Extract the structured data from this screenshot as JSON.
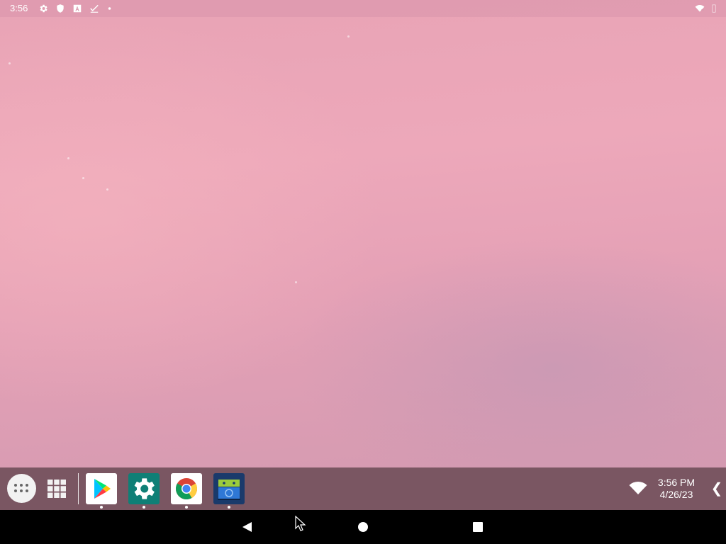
{
  "status_bar": {
    "time": "3:56",
    "icons": [
      "gear-icon",
      "shield-icon",
      "font-a-icon",
      "checkmark-icon",
      "dot-icon",
      "wifi-icon",
      "battery-icon"
    ]
  },
  "taskbar": {
    "apps_button_icon": "app-drawer-dots-icon",
    "recents_icon": "grid-icon",
    "pinned_apps": [
      {
        "name": "Play Store",
        "icon": "play-store-icon",
        "running": true
      },
      {
        "name": "Settings",
        "icon": "settings-gear-icon",
        "running": true,
        "bg": "#0f7f76"
      },
      {
        "name": "Chrome",
        "icon": "chrome-icon",
        "running": true
      },
      {
        "name": "App",
        "icon": "android-app-icon",
        "running": true,
        "bg": "#1a3a6b"
      }
    ],
    "tray": {
      "time": "3:56 PM",
      "date": "4/26/23",
      "chevron": "❮"
    }
  },
  "nav_bar": {
    "buttons": [
      "back-icon",
      "home-icon",
      "recents-icon"
    ]
  },
  "colors": {
    "wallpaper_pink": "#eaa6b8",
    "taskbar": "#7a5662",
    "settings_teal": "#0f7f76"
  }
}
